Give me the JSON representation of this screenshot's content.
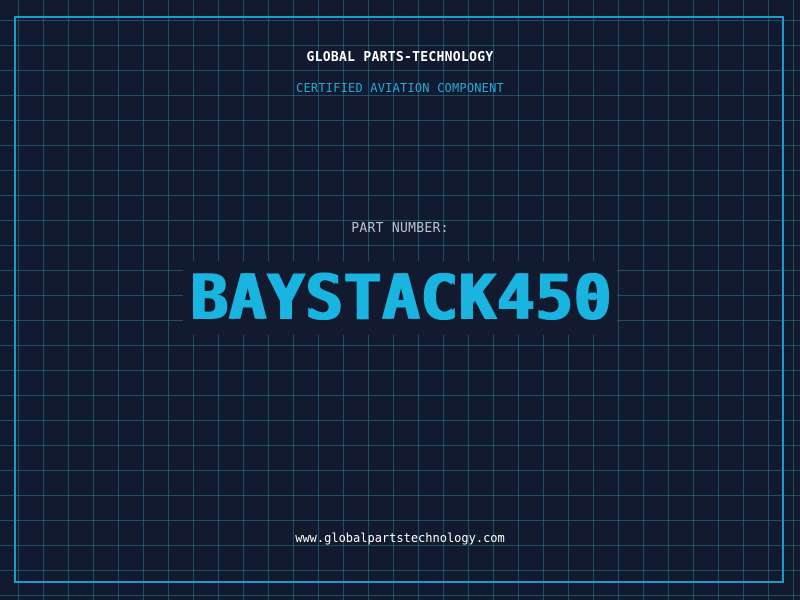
{
  "header": {
    "brand": "GLOBAL PARTS-TECHNOLOGY",
    "tagline": "CERTIFIED AVIATION COMPONENT"
  },
  "part": {
    "label": "PART NUMBER:",
    "number": "BAYSTACK450"
  },
  "footer": {
    "website": "www.globalpartstechnology.com"
  },
  "colors": {
    "background": "#111a2e",
    "grid": "#26789a",
    "accent": "#1ab4e0",
    "frame": "#1b9ccc",
    "text_primary": "#ffffff",
    "text_muted": "#b9c3cf"
  }
}
